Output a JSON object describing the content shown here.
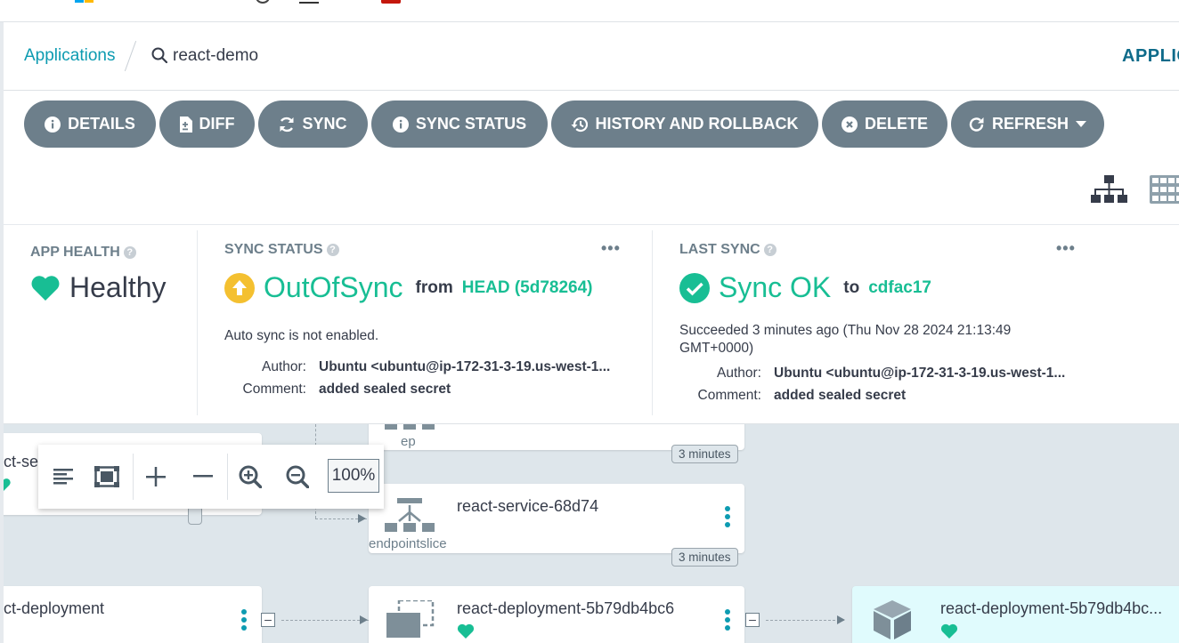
{
  "breadcrumb": {
    "root": "Applications",
    "current": "react-demo",
    "right_label": "APPLIC"
  },
  "toolbar": {
    "buttons": [
      {
        "label": "DETAILS",
        "icon": "info-circle-icon"
      },
      {
        "label": "DIFF",
        "icon": "file-diff-icon"
      },
      {
        "label": "SYNC",
        "icon": "sync-arrows-icon"
      },
      {
        "label": "SYNC STATUS",
        "icon": "info-circle-icon"
      },
      {
        "label": "HISTORY AND ROLLBACK",
        "icon": "history-icon"
      },
      {
        "label": "DELETE",
        "icon": "times-circle-icon"
      },
      {
        "label": "REFRESH",
        "icon": "redo-icon"
      }
    ]
  },
  "view_icons": [
    "tree-view-icon",
    "grid-view-icon"
  ],
  "status": {
    "app_health": {
      "label": "APP HEALTH",
      "value": "Healthy"
    },
    "sync_status": {
      "label": "SYNC STATUS",
      "value": "OutOfSync",
      "from_text": "from",
      "revision": "HEAD (5d78264)",
      "auto_sync": "Auto sync is not enabled.",
      "author_key": "Author:",
      "author": "Ubuntu <ubuntu@ip-172-31-3-19.us-west-1...",
      "comment_key": "Comment:",
      "comment": "added sealed secret",
      "menu": "•••"
    },
    "last_sync": {
      "label": "LAST SYNC",
      "value": "Sync OK",
      "to_text": "to",
      "revision": "cdfac17",
      "succeeded": "Succeeded 3 minutes ago (Thu Nov 28 2024 21:13:49 GMT+0000)",
      "author_key": "Author:",
      "author": "Ubuntu <ubuntu@ip-172-31-3-19.us-west-1...",
      "comment_key": "Comment:",
      "comment": "added sealed secret",
      "menu": "•••"
    }
  },
  "graph": {
    "nodes": [
      {
        "title": "ct-ser",
        "kind": "",
        "age": ""
      },
      {
        "title": "",
        "kind": "ep",
        "age": "3 minutes"
      },
      {
        "title": "react-service-68d74",
        "kind": "endpointslice",
        "age": "3 minutes"
      },
      {
        "title": "ct-deployment",
        "kind": "",
        "age": ""
      },
      {
        "title": "react-deployment-5b79db4bc6",
        "kind": "",
        "age": ""
      },
      {
        "title": "react-deployment-5b79db4bc...",
        "kind": "",
        "age": ""
      }
    ],
    "minus_symbol": "–"
  },
  "zoom": {
    "level": "100%"
  },
  "colors": {
    "button_bg": "#6d7f8b",
    "accent_teal": "#0d9bb1",
    "healthy_green": "#18be94",
    "outofsync_yellow": "#f4c030",
    "graph_bg": "#dee6eb",
    "pod_node_bg": "#e0fbfd"
  }
}
